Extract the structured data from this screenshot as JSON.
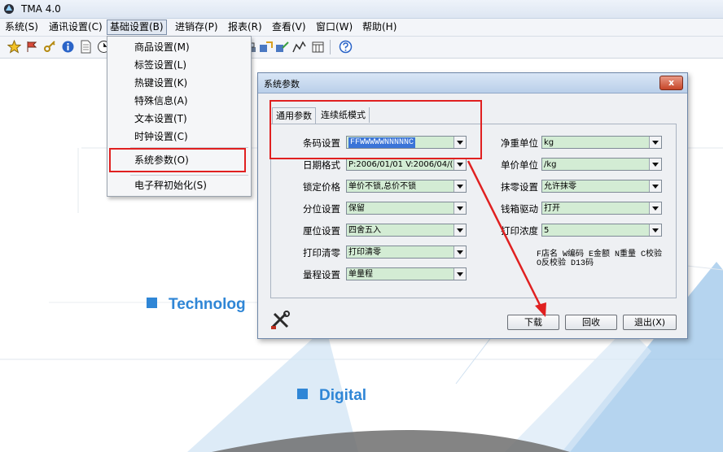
{
  "app": {
    "title": "TMA 4.0"
  },
  "menu": {
    "items": [
      "系统(S)",
      "通讯设置(C)",
      "基础设置(B)",
      "进销存(P)",
      "报表(R)",
      "查看(V)",
      "窗口(W)",
      "帮助(H)"
    ],
    "active": "基础设置(B)"
  },
  "dropdown": {
    "items": [
      "商品设置(M)",
      "标签设置(L)",
      "热键设置(K)",
      "特殊信息(A)",
      "文本设置(T)",
      "时钟设置(C)",
      "系统参数(O)",
      "电子秤初始化(S)"
    ],
    "highlighted": "系统参数(O)"
  },
  "background": {
    "label1": "Technolog",
    "label2": "Digital",
    "accent": "#2f86d6"
  },
  "dialog": {
    "title": "系统参数",
    "close": "x",
    "tabs": [
      "通用参数",
      "连续纸模式"
    ],
    "left_fields": [
      {
        "label": "条码设置",
        "value": "FFWWWWWNNNNNC",
        "selected": true
      },
      {
        "label": "日期格式",
        "value": "P:2006/01/01 V:2006/04/("
      },
      {
        "label": "锁定价格",
        "value": "单价不锁,总价不锁"
      },
      {
        "label": "分位设置",
        "value": "保留"
      },
      {
        "label": "厘位设置",
        "value": "四舍五入"
      },
      {
        "label": "打印清零",
        "value": "打印清零"
      },
      {
        "label": "量程设置",
        "value": "单量程"
      }
    ],
    "right_fields": [
      {
        "label": "净重单位",
        "value": "kg"
      },
      {
        "label": "单价单位",
        "value": "/kg"
      },
      {
        "label": "抹零设置",
        "value": "允许抹零"
      },
      {
        "label": "钱箱驱动",
        "value": "打开"
      },
      {
        "label": "打印浓度",
        "value": "5"
      }
    ],
    "note_line1": "F店名 W编码 E金额 N重量 C校验",
    "note_line2": "O反校验 D13码",
    "buttons": {
      "download": "下载",
      "recall": "回收",
      "exit": "退出(X)"
    }
  },
  "colors": {
    "highlight_box": "#e02020",
    "field_bg": "#d3ecd4",
    "selection": "#3b74d8"
  }
}
